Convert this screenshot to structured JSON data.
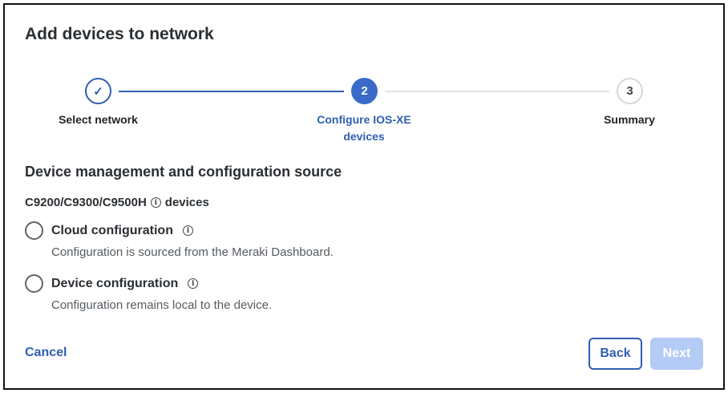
{
  "dialog": {
    "title": "Add devices to network"
  },
  "stepper": {
    "steps": [
      {
        "label": "Select network",
        "state": "complete",
        "marker": "✓"
      },
      {
        "label": "Configure IOS-XE devices",
        "state": "current",
        "marker": "2"
      },
      {
        "label": "Summary",
        "state": "upcoming",
        "marker": "3"
      }
    ]
  },
  "section": {
    "title": "Device management and configuration source",
    "group_before": "C9200/C9300/C9500H",
    "group_after": "devices",
    "info_glyph": "i"
  },
  "options": [
    {
      "label": "Cloud configuration",
      "description": "Configuration is sourced from the Meraki Dashboard.",
      "selected": false
    },
    {
      "label": "Device configuration",
      "description": "Configuration remains local to the device.",
      "selected": false
    }
  ],
  "footer": {
    "cancel": "Cancel",
    "back": "Back",
    "next": "Next"
  },
  "colors": {
    "accent": "#2f5fb3",
    "disabled": "#b3cbf5"
  }
}
